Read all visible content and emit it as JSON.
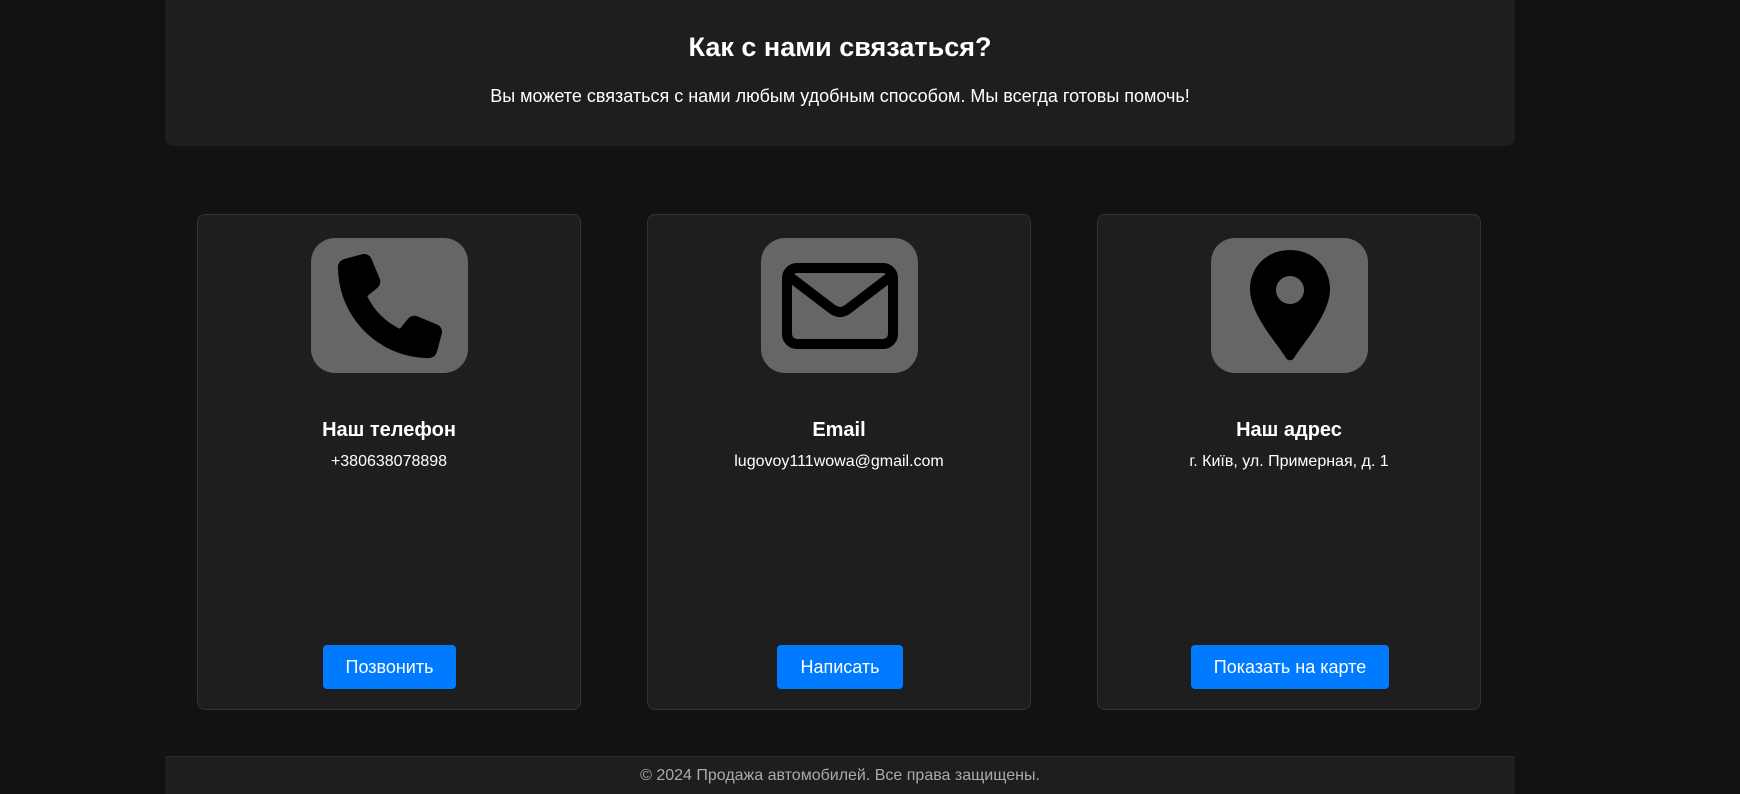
{
  "hero": {
    "title": "Как с нами связаться?",
    "subtitle": "Вы можете связаться с нами любым удобным способом. Мы всегда готовы помочь!"
  },
  "cards": [
    {
      "icon": "phone-icon",
      "title": "Наш телефон",
      "info": "+380638078898",
      "button": "Позвонить"
    },
    {
      "icon": "envelope-icon",
      "title": "Email",
      "info": "lugovoy111wowa@gmail.com",
      "button": "Написать"
    },
    {
      "icon": "map-pin-icon",
      "title": "Наш адрес",
      "info": "г. Київ, ул. Примерная, д. 1",
      "button": "Показать на карте"
    }
  ],
  "footer": {
    "text": "© 2024 Продажа автомобилей. Все права защищены."
  },
  "colors": {
    "background": "#121212",
    "panel": "#1e1e1e",
    "icon_tile": "#666666",
    "accent": "#007bff"
  }
}
